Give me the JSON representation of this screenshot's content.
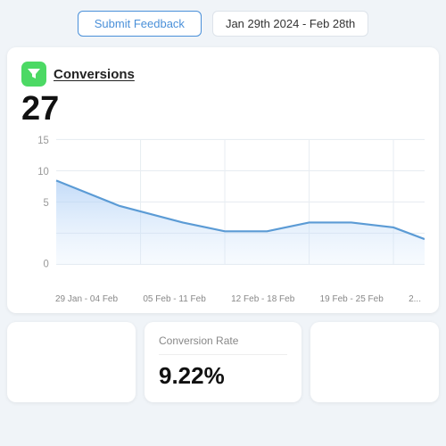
{
  "topbar": {
    "submit_feedback_label": "Submit Feedback",
    "date_range": "Jan 29th 2024 - Feb 28th"
  },
  "conversions_card": {
    "title": "Conversions",
    "total": "27",
    "icon_label": "funnel-icon",
    "chart": {
      "y_labels": [
        "15",
        "10",
        "5",
        "0"
      ],
      "x_labels": [
        "29 Jan - 04 Feb",
        "05 Feb - 11 Feb",
        "12 Feb - 18 Feb",
        "19 Feb - 25 Feb",
        "2..."
      ],
      "data_points": [
        {
          "x": 0,
          "y": 10
        },
        {
          "x": 1,
          "y": 7
        },
        {
          "x": 2,
          "y": 5
        },
        {
          "x": 3,
          "y": 4
        },
        {
          "x": 4,
          "y": 5
        },
        {
          "x": 5,
          "y": 5
        },
        {
          "x": 6,
          "y": 3
        }
      ]
    }
  },
  "bottom_cards": {
    "conversion_rate": {
      "label": "Conversion Rate",
      "value": "9.22%"
    }
  }
}
